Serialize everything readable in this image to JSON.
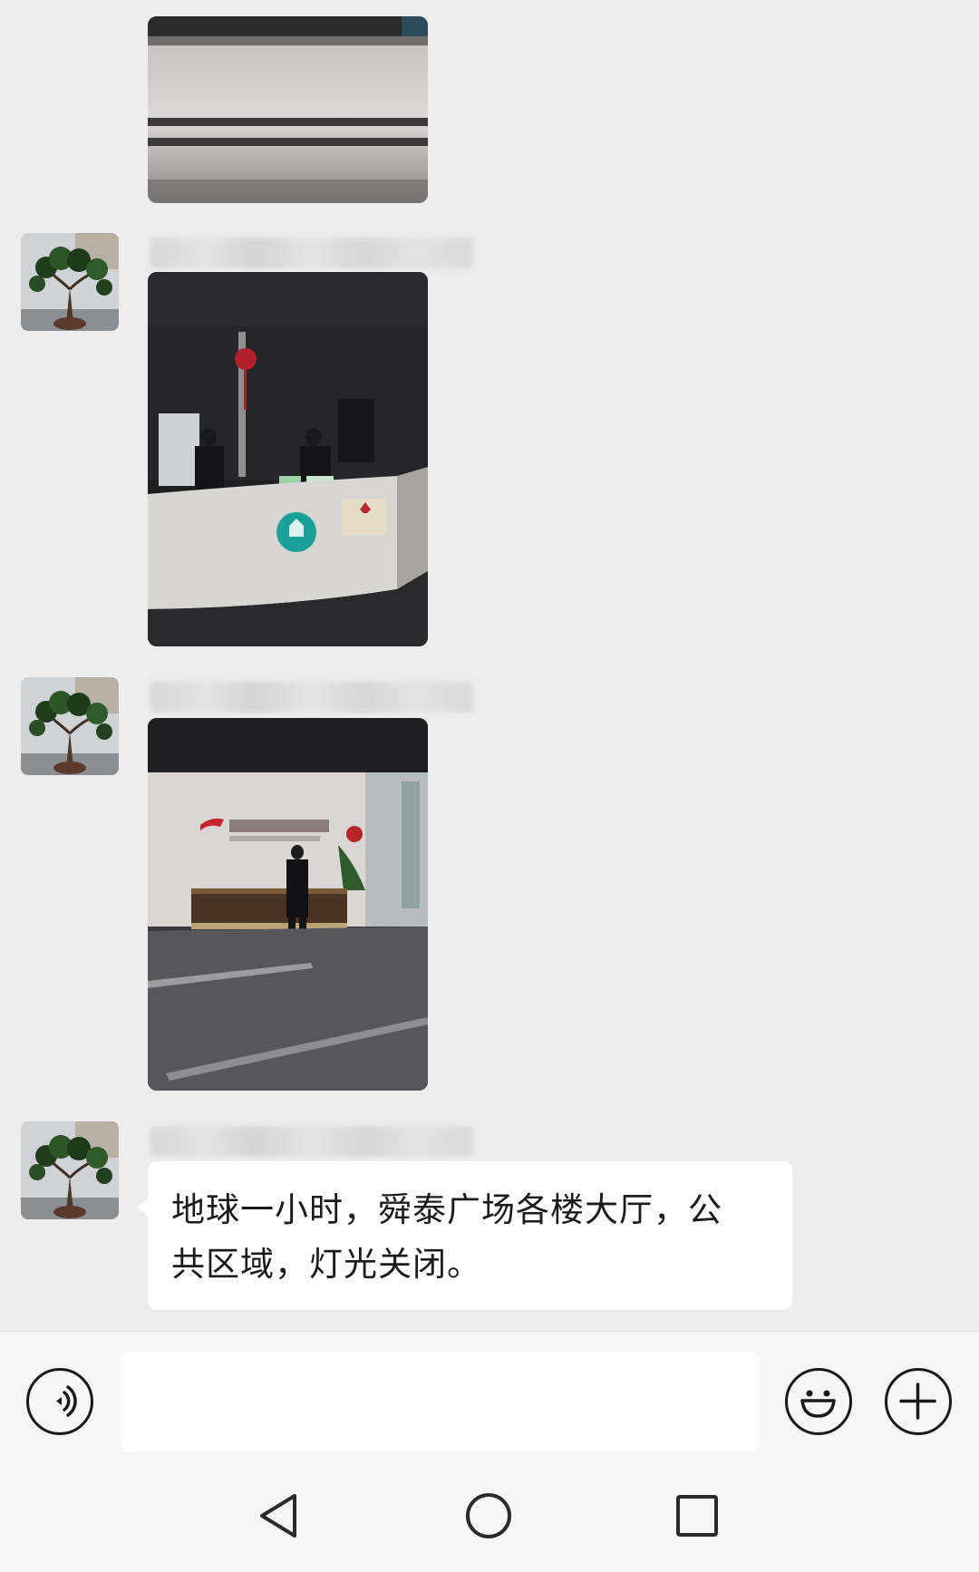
{
  "messages": [
    {
      "type": "image",
      "image": "photo-of-reception-desk-base-in-dim-lobby"
    },
    {
      "type": "image",
      "avatar": "bonsai-tree-avatar",
      "sender_name_blurred": true,
      "image": "photo-of-two-security-guards-behind-dark-reception-counter"
    },
    {
      "type": "image",
      "avatar": "bonsai-tree-avatar",
      "sender_name_blurred": true,
      "image": "photo-of-person-walking-through-dark-company-lobby"
    },
    {
      "type": "text",
      "avatar": "bonsai-tree-avatar",
      "sender_name_blurred": true,
      "text_line1": "地球一小时，舜泰广场各楼大厅，公",
      "text_line2": "共区域，灯光关闭。"
    }
  ],
  "input_bar": {
    "voice_icon": "voice-icon",
    "input_value": "",
    "emoji_icon": "emoji-icon",
    "plus_icon": "plus-icon"
  },
  "nav_bar": {
    "back_icon": "back-triangle-icon",
    "home_icon": "home-circle-icon",
    "recents_icon": "recents-square-icon"
  },
  "colors": {
    "chat_background": "#ededed",
    "bubble": "#ffffff",
    "bar_background": "#f6f6f6",
    "icon": "#1a1a1a"
  }
}
